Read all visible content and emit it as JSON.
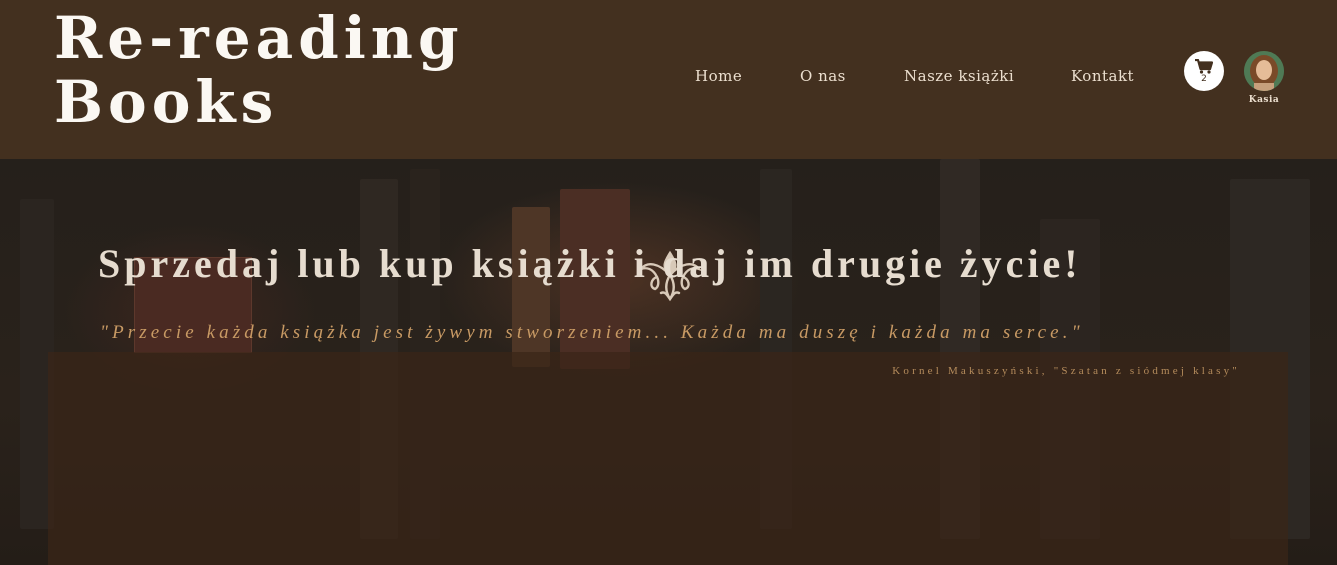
{
  "header": {
    "logo_line1": "Re-reading",
    "logo_line2": "Books",
    "nav": [
      {
        "label": "Home"
      },
      {
        "label": "O nas"
      },
      {
        "label": "Nasze książki"
      },
      {
        "label": "Kontakt"
      }
    ],
    "cart": {
      "icon": "cart-icon",
      "count": "2"
    },
    "user": {
      "name": "Kasia",
      "icon": "avatar"
    }
  },
  "hero": {
    "ornament_icon": "ornament-icon",
    "headline": "Sprzedaj lub kup książki i daj im drugie życie!",
    "quote": "\"Przecie każda książka jest żywym stworzeniem... Każda ma duszę i każda ma serce.\"",
    "author": "Kornel Makuszyński, \"Szatan z siódmej klasy\""
  },
  "colors": {
    "header_bg": "#43301f",
    "nav_text": "#ecdfcf",
    "headline": "#e6dccf",
    "quote": "#c89a64"
  }
}
